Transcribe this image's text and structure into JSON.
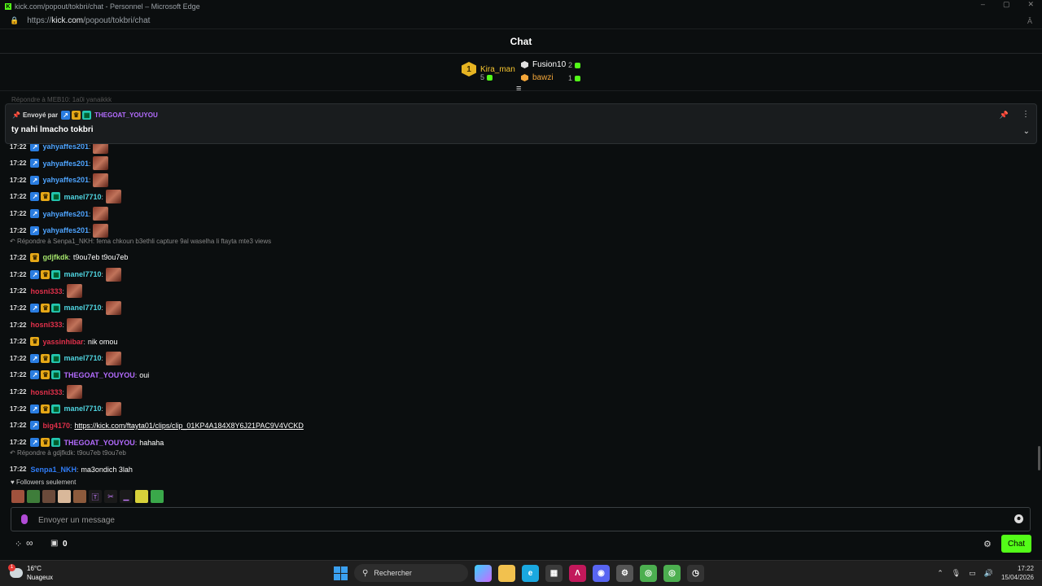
{
  "window": {
    "title": "kick.com/popout/tokbri/chat - Personnel – Microsoft Edge",
    "controls": [
      "–",
      "▢",
      "✕"
    ]
  },
  "address": {
    "prefix": "https://",
    "host": "kick.com",
    "path": "/popout/tokbri/chat",
    "reader_label": "Â"
  },
  "header": {
    "title": "Chat"
  },
  "leaderboard": {
    "first": {
      "rank": "1",
      "name": "Kira_man",
      "score": "5"
    },
    "others": [
      {
        "name": "Fusion10",
        "score": "2",
        "color": "#ffffff",
        "hex": "#e0e0e0"
      },
      {
        "name": "bawzi",
        "score": "1",
        "color": "#f4a73a",
        "hex": "#f4a73a"
      }
    ],
    "collapse_icon": "≡"
  },
  "faded_reply": "Répondre à MEB10: 1a0i yanaikkk",
  "pinned": {
    "sent_by_label": "Envoyé par",
    "user": "THEGOAT_YOUYOU",
    "message": "ty nahi lmacho tokbri",
    "pin_icon": "pin-icon",
    "more_icon": "⋮",
    "chevron_icon": "⌄"
  },
  "messages": [
    {
      "time": "17:22",
      "user": "yahyaffes201",
      "color": "#4ea4ff",
      "badges": [
        "blue"
      ],
      "emote": true,
      "text": ""
    },
    {
      "time": "17:22",
      "user": "yahyaffes201",
      "color": "#4ea4ff",
      "badges": [
        "blue"
      ],
      "emote": true,
      "text": ""
    },
    {
      "time": "17:22",
      "user": "yahyaffes201",
      "color": "#4ea4ff",
      "badges": [
        "blue"
      ],
      "emote": true,
      "text": ""
    },
    {
      "time": "17:22",
      "user": "manel7710",
      "color": "#4fd4e0",
      "badges": [
        "blue",
        "gold",
        "teal"
      ],
      "emote": true,
      "text": ""
    },
    {
      "time": "17:22",
      "user": "yahyaffes201",
      "color": "#4ea4ff",
      "badges": [
        "blue"
      ],
      "emote": true,
      "text": ""
    },
    {
      "time": "17:22",
      "user": "yahyaffes201",
      "color": "#4ea4ff",
      "badges": [
        "blue"
      ],
      "emote": true,
      "text": ""
    },
    {
      "reply": "Répondre à Senpa1_NKH: fema chkoun b3ethli capture 9al waselha li ftayta mte3 views"
    },
    {
      "time": "17:22",
      "user": "gdjfkdk",
      "color": "#a3e36b",
      "badges": [
        "gold"
      ],
      "emote": false,
      "text": "t9ou7eb t9ou7eb"
    },
    {
      "time": "17:22",
      "user": "manel7710",
      "color": "#4fd4e0",
      "badges": [
        "blue",
        "gold",
        "teal"
      ],
      "emote": true,
      "text": ""
    },
    {
      "time": "17:22",
      "user": "hosni333",
      "color": "#e0304a",
      "badges": [],
      "emote": true,
      "text": ""
    },
    {
      "time": "17:22",
      "user": "manel7710",
      "color": "#4fd4e0",
      "badges": [
        "blue",
        "gold",
        "teal"
      ],
      "emote": true,
      "text": ""
    },
    {
      "time": "17:22",
      "user": "hosni333",
      "color": "#e0304a",
      "badges": [],
      "emote": true,
      "text": ""
    },
    {
      "time": "17:22",
      "user": "yassinhibar",
      "color": "#e0304a",
      "badges": [
        "gold"
      ],
      "emote": false,
      "text": "nik omou"
    },
    {
      "time": "17:22",
      "user": "manel7710",
      "color": "#4fd4e0",
      "badges": [
        "blue",
        "gold",
        "teal"
      ],
      "emote": true,
      "text": ""
    },
    {
      "time": "17:22",
      "user": "THEGOAT_YOUYOU",
      "color": "#b46cff",
      "badges": [
        "blue",
        "gold",
        "teal"
      ],
      "emote": false,
      "text": "oui"
    },
    {
      "time": "17:22",
      "user": "hosni333",
      "color": "#e0304a",
      "badges": [],
      "emote": true,
      "text": ""
    },
    {
      "time": "17:22",
      "user": "manel7710",
      "color": "#4fd4e0",
      "badges": [
        "blue",
        "gold",
        "teal"
      ],
      "emote": true,
      "text": ""
    },
    {
      "time": "17:22",
      "user": "big4170",
      "color": "#e0304a",
      "badges": [
        "blue"
      ],
      "emote": false,
      "link": "https://kick.com/ftayta01/clips/clip_01KP4A184X8Y6J21PAC9V4VCKD"
    },
    {
      "time": "17:22",
      "user": "THEGOAT_YOUYOU",
      "color": "#b46cff",
      "badges": [
        "blue",
        "gold",
        "teal"
      ],
      "emote": false,
      "text": "hahaha"
    },
    {
      "reply": "Répondre à gdjfkdk: t9ou7eb t9ou7eb"
    },
    {
      "time": "17:22",
      "user": "Senpa1_NKH",
      "color": "#2f7cf6",
      "badges": [],
      "emote": false,
      "text": "ma3ondich 3lah"
    }
  ],
  "followers_label": "Followers seulement",
  "emote_bar": [
    {
      "name": "emote-face-1",
      "bg": "#a0523d",
      "glyph": ""
    },
    {
      "name": "emote-frog",
      "bg": "#3e7d3a",
      "glyph": ""
    },
    {
      "name": "emote-face-2",
      "bg": "#6b4a3a",
      "glyph": ""
    },
    {
      "name": "emote-face-3",
      "bg": "#d9b89a",
      "glyph": ""
    },
    {
      "name": "emote-face-4",
      "bg": "#8c5a3c",
      "glyph": ""
    },
    {
      "name": "emote-text",
      "bg": "#1a1a1a",
      "glyph": "🅃"
    },
    {
      "name": "emote-purple",
      "bg": "#1a1a1a",
      "glyph": "✂"
    },
    {
      "name": "emote-dash",
      "bg": "#1a1a1a",
      "glyph": "▁"
    },
    {
      "name": "emote-cat",
      "bg": "#d8d13a",
      "glyph": ""
    },
    {
      "name": "emote-kick",
      "bg": "#3aa84a",
      "glyph": ""
    }
  ],
  "input": {
    "placeholder": "Envoyer un message"
  },
  "bottom": {
    "points_icon": "⁘",
    "infinity": "∞",
    "gift_count": "0",
    "chat_button": "Chat"
  },
  "taskbar": {
    "temp": "16°C",
    "weather": "Nuageux",
    "weather_badge": "1",
    "search_label": "Rechercher",
    "apps": [
      {
        "name": "copilot-icon",
        "bg": "linear-gradient(135deg,#3ad1ff,#c86bff)",
        "glyph": ""
      },
      {
        "name": "file-explorer-icon",
        "bg": "#f2c14e",
        "glyph": ""
      },
      {
        "name": "edge-icon",
        "bg": "#1aa8e0",
        "glyph": "e"
      },
      {
        "name": "store-icon",
        "bg": "#3b3b3b",
        "glyph": "▦"
      },
      {
        "name": "affinity-icon",
        "bg": "#c2185b",
        "glyph": "Λ"
      },
      {
        "name": "discord-icon",
        "bg": "#5865f2",
        "glyph": "◉"
      },
      {
        "name": "settings-app-icon",
        "bg": "#555",
        "glyph": "⚙"
      },
      {
        "name": "chrome-icon",
        "bg": "#4caf50",
        "glyph": "◎"
      },
      {
        "name": "chrome-2-icon",
        "bg": "#4caf50",
        "glyph": "◎"
      },
      {
        "name": "clock-app-icon",
        "bg": "#333",
        "glyph": "◷"
      }
    ],
    "tray_chevron": "⌃",
    "time": "17:22",
    "date": "15/04/2026"
  }
}
